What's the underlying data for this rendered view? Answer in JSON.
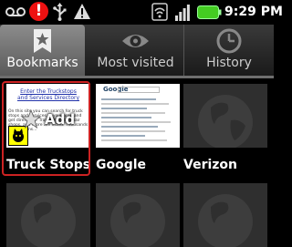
{
  "status_bar": {
    "time": "9:29 PM",
    "icons": [
      "voicemail-icon",
      "alert-icon",
      "usb-icon",
      "warning-icon",
      "wifi-icon",
      "signal-icon",
      "battery-icon"
    ],
    "alert_symbol": "!"
  },
  "tabs": [
    {
      "label": "Bookmarks",
      "icon": "bookmark-star-icon",
      "selected": true
    },
    {
      "label": "Most visited",
      "icon": "eye-icon",
      "selected": false
    },
    {
      "label": "History",
      "icon": "clock-icon",
      "selected": false
    }
  ],
  "grid": {
    "items": [
      {
        "label": "Truck Stops a",
        "thumb": "page",
        "selected": true,
        "thumb_title": "Enter the Truckstops and Services Directory",
        "thumb_text": "On this site you can search for truck stops and services in your area and get directions. Travel Plazas, repair shops, and more are listed. Thousands of Locations...",
        "add_label": "Add"
      },
      {
        "label": "Google",
        "thumb": "page",
        "selected": false,
        "thumb_logo": "Google"
      },
      {
        "label": "Verizon",
        "thumb": "globe",
        "selected": false
      },
      {
        "label": "",
        "thumb": "globe",
        "selected": false
      },
      {
        "label": "",
        "thumb": "globe",
        "selected": false
      },
      {
        "label": "",
        "thumb": "globe",
        "selected": false
      }
    ]
  },
  "colors": {
    "selected_border": "#cc2222",
    "alert": "#ee1111",
    "battery": "#44cc22"
  }
}
